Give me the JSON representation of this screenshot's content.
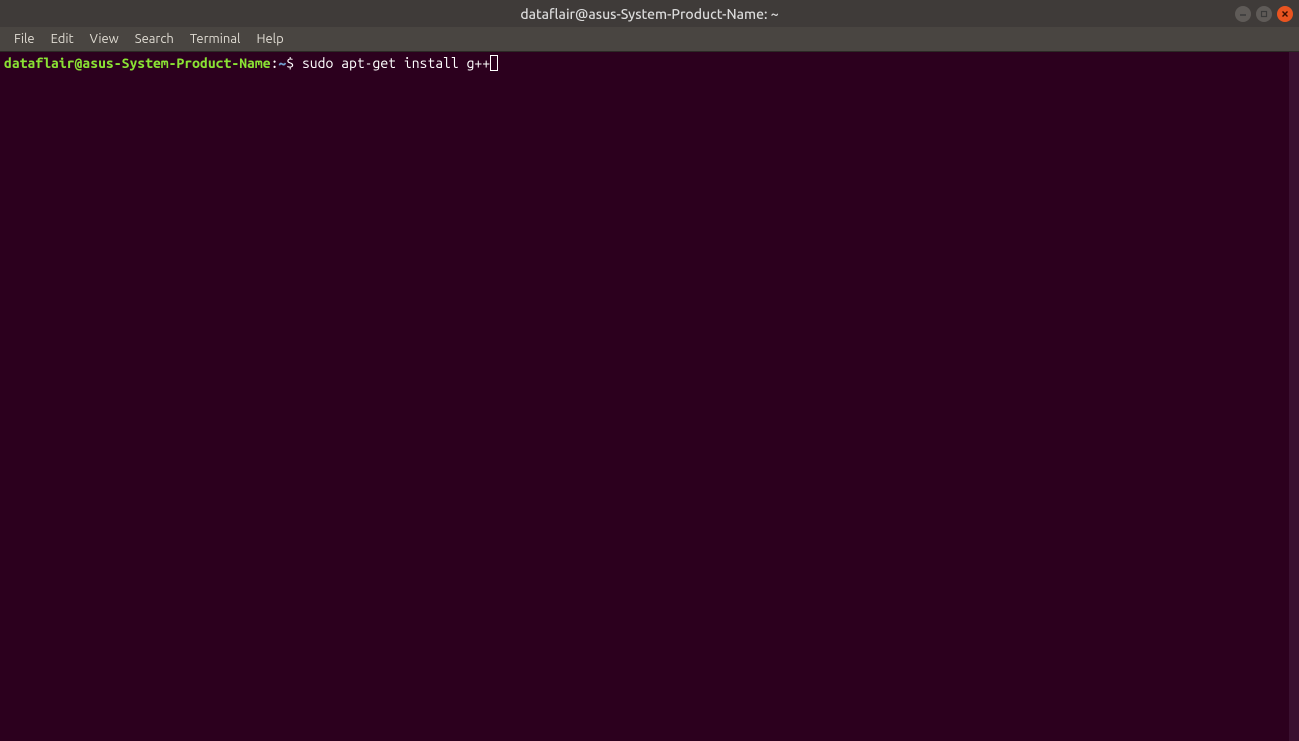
{
  "window": {
    "title": "dataflair@asus-System-Product-Name: ~"
  },
  "menubar": {
    "items": [
      "File",
      "Edit",
      "View",
      "Search",
      "Terminal",
      "Help"
    ]
  },
  "terminal": {
    "prompt_user": "dataflair@asus-System-Product-Name",
    "prompt_sep": ":",
    "prompt_path": "~",
    "prompt_dollar": "$ ",
    "command": "sudo apt-get install g++"
  }
}
